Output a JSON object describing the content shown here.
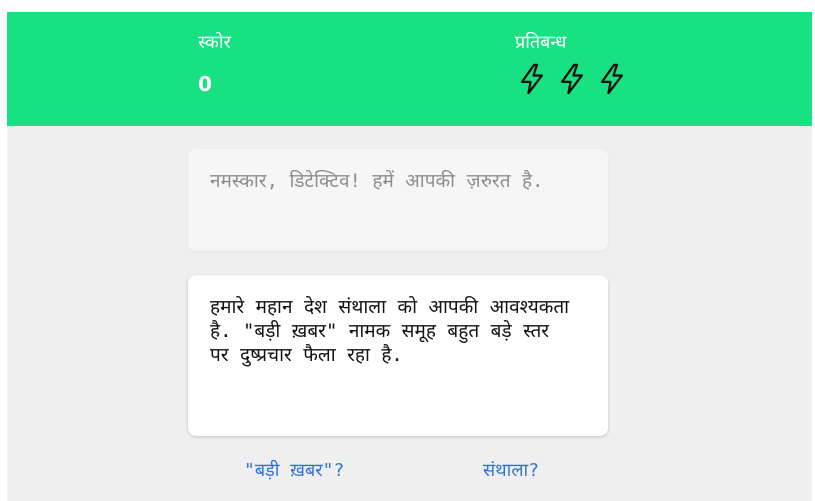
{
  "header": {
    "score_label": "स्कोर",
    "score_value": "0",
    "lives_label": "प्रतिबन्ध",
    "lives_count": 3,
    "life_icon": "lightning-bolt-icon"
  },
  "messages": [
    {
      "text": "नमस्कार, डिटेक्टिव! हमें आपकी ज़रुरत है.",
      "state": "previous"
    },
    {
      "text": "हमारे महान देश संथाला को आपकी आवश्यकता है. \"बड़ी ख़बर\" नामक समूह बहुत बड़े स्तर पर दुष्प्रचार फैला रहा है.",
      "state": "current"
    }
  ],
  "choices": [
    {
      "label": "\"बड़ी ख़बर\"?"
    },
    {
      "label": "संथाला?"
    }
  ],
  "colors": {
    "header_bg": "#17e180",
    "page_bg": "#efefef",
    "choice_link": "#2f74d0",
    "previous_text": "#8d8d8d"
  }
}
